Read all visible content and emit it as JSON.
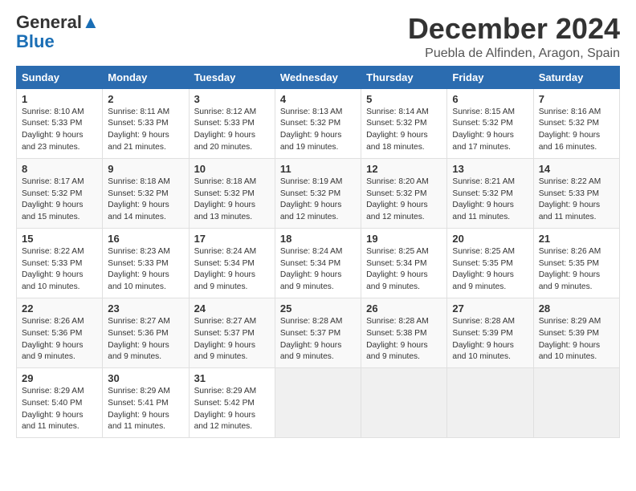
{
  "logo": {
    "line1": "General",
    "line2": "Blue"
  },
  "title": "December 2024",
  "location": "Puebla de Alfinden, Aragon, Spain",
  "days_of_week": [
    "Sunday",
    "Monday",
    "Tuesday",
    "Wednesday",
    "Thursday",
    "Friday",
    "Saturday"
  ],
  "weeks": [
    [
      {
        "day": "1",
        "lines": [
          "Sunrise: 8:10 AM",
          "Sunset: 5:33 PM",
          "Daylight: 9 hours",
          "and 23 minutes."
        ]
      },
      {
        "day": "2",
        "lines": [
          "Sunrise: 8:11 AM",
          "Sunset: 5:33 PM",
          "Daylight: 9 hours",
          "and 21 minutes."
        ]
      },
      {
        "day": "3",
        "lines": [
          "Sunrise: 8:12 AM",
          "Sunset: 5:33 PM",
          "Daylight: 9 hours",
          "and 20 minutes."
        ]
      },
      {
        "day": "4",
        "lines": [
          "Sunrise: 8:13 AM",
          "Sunset: 5:32 PM",
          "Daylight: 9 hours",
          "and 19 minutes."
        ]
      },
      {
        "day": "5",
        "lines": [
          "Sunrise: 8:14 AM",
          "Sunset: 5:32 PM",
          "Daylight: 9 hours",
          "and 18 minutes."
        ]
      },
      {
        "day": "6",
        "lines": [
          "Sunrise: 8:15 AM",
          "Sunset: 5:32 PM",
          "Daylight: 9 hours",
          "and 17 minutes."
        ]
      },
      {
        "day": "7",
        "lines": [
          "Sunrise: 8:16 AM",
          "Sunset: 5:32 PM",
          "Daylight: 9 hours",
          "and 16 minutes."
        ]
      }
    ],
    [
      {
        "day": "8",
        "lines": [
          "Sunrise: 8:17 AM",
          "Sunset: 5:32 PM",
          "Daylight: 9 hours",
          "and 15 minutes."
        ]
      },
      {
        "day": "9",
        "lines": [
          "Sunrise: 8:18 AM",
          "Sunset: 5:32 PM",
          "Daylight: 9 hours",
          "and 14 minutes."
        ]
      },
      {
        "day": "10",
        "lines": [
          "Sunrise: 8:18 AM",
          "Sunset: 5:32 PM",
          "Daylight: 9 hours",
          "and 13 minutes."
        ]
      },
      {
        "day": "11",
        "lines": [
          "Sunrise: 8:19 AM",
          "Sunset: 5:32 PM",
          "Daylight: 9 hours",
          "and 12 minutes."
        ]
      },
      {
        "day": "12",
        "lines": [
          "Sunrise: 8:20 AM",
          "Sunset: 5:32 PM",
          "Daylight: 9 hours",
          "and 12 minutes."
        ]
      },
      {
        "day": "13",
        "lines": [
          "Sunrise: 8:21 AM",
          "Sunset: 5:32 PM",
          "Daylight: 9 hours",
          "and 11 minutes."
        ]
      },
      {
        "day": "14",
        "lines": [
          "Sunrise: 8:22 AM",
          "Sunset: 5:33 PM",
          "Daylight: 9 hours",
          "and 11 minutes."
        ]
      }
    ],
    [
      {
        "day": "15",
        "lines": [
          "Sunrise: 8:22 AM",
          "Sunset: 5:33 PM",
          "Daylight: 9 hours",
          "and 10 minutes."
        ]
      },
      {
        "day": "16",
        "lines": [
          "Sunrise: 8:23 AM",
          "Sunset: 5:33 PM",
          "Daylight: 9 hours",
          "and 10 minutes."
        ]
      },
      {
        "day": "17",
        "lines": [
          "Sunrise: 8:24 AM",
          "Sunset: 5:34 PM",
          "Daylight: 9 hours",
          "and 9 minutes."
        ]
      },
      {
        "day": "18",
        "lines": [
          "Sunrise: 8:24 AM",
          "Sunset: 5:34 PM",
          "Daylight: 9 hours",
          "and 9 minutes."
        ]
      },
      {
        "day": "19",
        "lines": [
          "Sunrise: 8:25 AM",
          "Sunset: 5:34 PM",
          "Daylight: 9 hours",
          "and 9 minutes."
        ]
      },
      {
        "day": "20",
        "lines": [
          "Sunrise: 8:25 AM",
          "Sunset: 5:35 PM",
          "Daylight: 9 hours",
          "and 9 minutes."
        ]
      },
      {
        "day": "21",
        "lines": [
          "Sunrise: 8:26 AM",
          "Sunset: 5:35 PM",
          "Daylight: 9 hours",
          "and 9 minutes."
        ]
      }
    ],
    [
      {
        "day": "22",
        "lines": [
          "Sunrise: 8:26 AM",
          "Sunset: 5:36 PM",
          "Daylight: 9 hours",
          "and 9 minutes."
        ]
      },
      {
        "day": "23",
        "lines": [
          "Sunrise: 8:27 AM",
          "Sunset: 5:36 PM",
          "Daylight: 9 hours",
          "and 9 minutes."
        ]
      },
      {
        "day": "24",
        "lines": [
          "Sunrise: 8:27 AM",
          "Sunset: 5:37 PM",
          "Daylight: 9 hours",
          "and 9 minutes."
        ]
      },
      {
        "day": "25",
        "lines": [
          "Sunrise: 8:28 AM",
          "Sunset: 5:37 PM",
          "Daylight: 9 hours",
          "and 9 minutes."
        ]
      },
      {
        "day": "26",
        "lines": [
          "Sunrise: 8:28 AM",
          "Sunset: 5:38 PM",
          "Daylight: 9 hours",
          "and 9 minutes."
        ]
      },
      {
        "day": "27",
        "lines": [
          "Sunrise: 8:28 AM",
          "Sunset: 5:39 PM",
          "Daylight: 9 hours",
          "and 10 minutes."
        ]
      },
      {
        "day": "28",
        "lines": [
          "Sunrise: 8:29 AM",
          "Sunset: 5:39 PM",
          "Daylight: 9 hours",
          "and 10 minutes."
        ]
      }
    ],
    [
      {
        "day": "29",
        "lines": [
          "Sunrise: 8:29 AM",
          "Sunset: 5:40 PM",
          "Daylight: 9 hours",
          "and 11 minutes."
        ]
      },
      {
        "day": "30",
        "lines": [
          "Sunrise: 8:29 AM",
          "Sunset: 5:41 PM",
          "Daylight: 9 hours",
          "and 11 minutes."
        ]
      },
      {
        "day": "31",
        "lines": [
          "Sunrise: 8:29 AM",
          "Sunset: 5:42 PM",
          "Daylight: 9 hours",
          "and 12 minutes."
        ]
      },
      null,
      null,
      null,
      null
    ]
  ]
}
